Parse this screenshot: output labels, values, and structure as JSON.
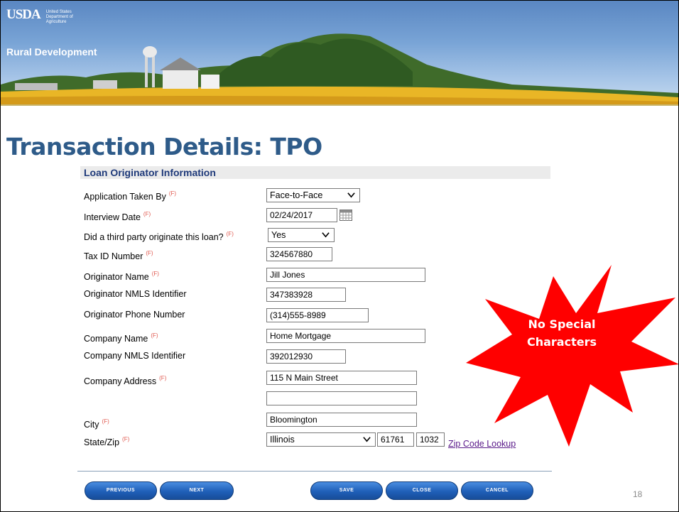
{
  "header": {
    "agency_short": "USDA",
    "agency_full": "United States Department of Agriculture",
    "division": "Rural Development"
  },
  "slide": {
    "title": "Transaction Details:  TPO",
    "page_number": "18"
  },
  "form": {
    "section_title": "Loan Originator Information",
    "required_marker": "(F)",
    "fields": {
      "application_taken_by": {
        "label": "Application Taken By",
        "value": "Face-to-Face"
      },
      "interview_date": {
        "label": "Interview Date",
        "value": "02/24/2017"
      },
      "third_party": {
        "label": "Did a third party originate this loan?",
        "value": "Yes"
      },
      "tax_id": {
        "label": "Tax ID Number",
        "value": "324567880"
      },
      "originator_name": {
        "label": "Originator Name",
        "value": "Jill Jones"
      },
      "originator_nmls": {
        "label": "Originator NMLS Identifier",
        "value": "347383928"
      },
      "originator_phone": {
        "label": "Originator Phone Number",
        "value": "(314)555-8989"
      },
      "company_name": {
        "label": "Company Name",
        "value": "Home Mortgage"
      },
      "company_nmls": {
        "label": "Company NMLS Identifier",
        "value": "392012930"
      },
      "company_address": {
        "label": "Company Address",
        "value": "115 N Main Street",
        "value2": ""
      },
      "city": {
        "label": "City",
        "value": "Bloomington"
      },
      "state_zip": {
        "label": "State/Zip",
        "state": "Illinois",
        "zip": "61761",
        "zip4": "1032"
      }
    },
    "zip_lookup_link": "Zip Code Lookup"
  },
  "buttons": {
    "previous": "PREVIOUS",
    "next": "NEXT",
    "save": "SAVE",
    "close": "CLOSE",
    "cancel": "CANCEL"
  },
  "callout": {
    "line1": "No Special",
    "line2": "Characters",
    "color": "#ff0000"
  },
  "colors": {
    "title": "#2e5b89",
    "section_title": "#1f3a7a",
    "required": "#e05a50",
    "button": "#1f5fb8",
    "link": "#5a1a8a"
  }
}
